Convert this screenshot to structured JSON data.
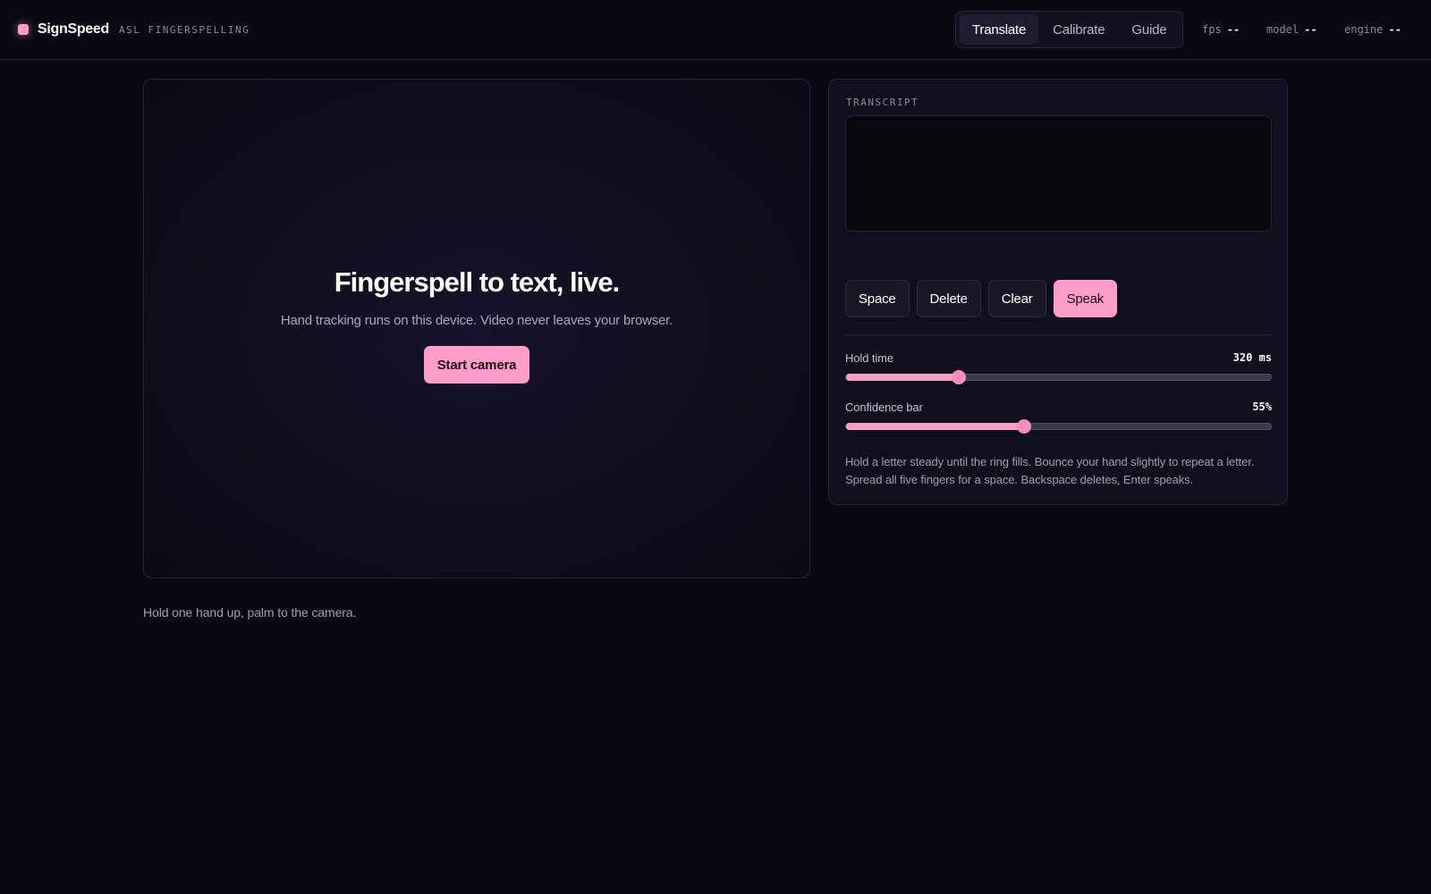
{
  "brand": {
    "name": "SignSpeed",
    "subtitle": "ASL FINGERSPELLING"
  },
  "nav": {
    "tabs": [
      {
        "label": "Translate",
        "active": true
      },
      {
        "label": "Calibrate",
        "active": false
      },
      {
        "label": "Guide",
        "active": false
      }
    ]
  },
  "stats": [
    {
      "key": "fps",
      "value": "--"
    },
    {
      "key": "model",
      "value": "--"
    },
    {
      "key": "engine",
      "value": "--"
    }
  ],
  "camera": {
    "title": "Fingerspell to text, live.",
    "subtitle": "Hand tracking runs on this device. Video never leaves your browser.",
    "start_label": "Start camera",
    "hint": "Hold one hand up, palm to the camera."
  },
  "transcript": {
    "label": "TRANSCRIPT",
    "value": ""
  },
  "actions": {
    "space": "Space",
    "delete": "Delete",
    "clear": "Clear",
    "speak": "Speak"
  },
  "sliders": {
    "hold_time": {
      "label": "Hold time",
      "display": "320 ms",
      "fraction": 0.265
    },
    "confidence": {
      "label": "Confidence bar",
      "display": "55%",
      "fraction": 0.418
    }
  },
  "help": "Hold a letter steady until the ring fills. Bounce your hand slightly to repeat a letter. Spread all five fingers for a space. Backspace deletes, Enter speaks.",
  "colors": {
    "accent": "#ff9cc8",
    "background": "#0a0913",
    "panel": "#100f1d"
  }
}
